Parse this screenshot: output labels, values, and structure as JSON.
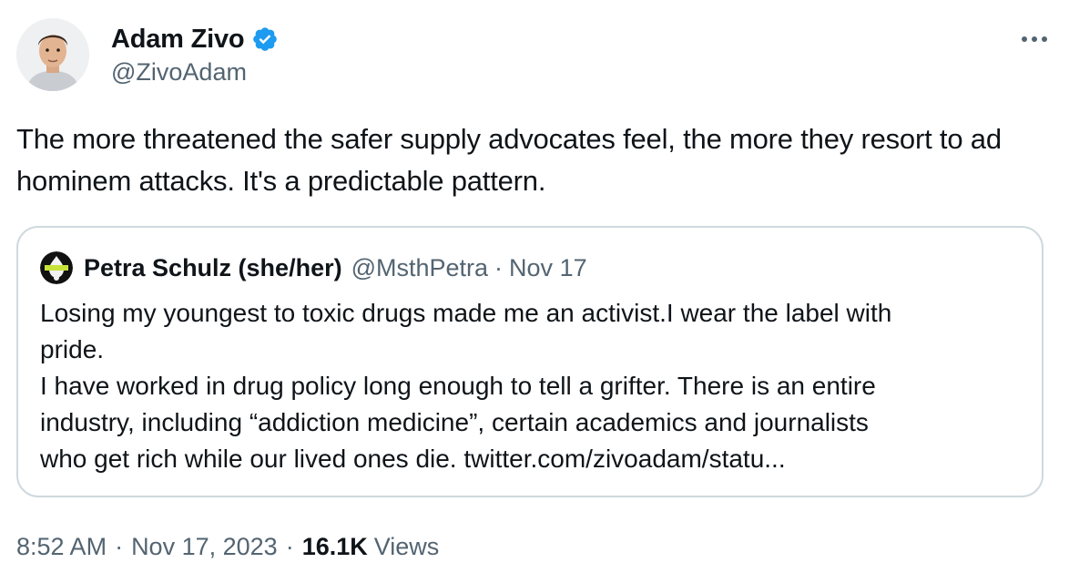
{
  "tweet": {
    "author": {
      "display_name": "Adam Zivo",
      "handle": "@ZivoAdam",
      "verified": true
    },
    "text": "The more threatened the safer supply advocates feel, the more they resort to ad hominem attacks. It's a predictable pattern.",
    "more_icon": "more-horizontal-icon",
    "quoted": {
      "display_name": "Petra Schulz (she/her)",
      "handle": "@MsthPetra",
      "dot": "·",
      "date": "Nov 17",
      "lines": [
        "Losing my youngest to toxic drugs made me an activist.I wear the label with",
        "pride.",
        "I have worked in drug policy long enough to tell a grifter. There is an entire",
        "industry, including “addiction medicine”, certain academics and journalists",
        "who get rich while our lived ones die. twitter.com/zivoadam/statu..."
      ]
    },
    "footer": {
      "time": "8:52 AM",
      "dot1": "·",
      "date": "Nov 17, 2023",
      "dot2": "·",
      "views_count": "16.1K",
      "views_label": "Views"
    }
  },
  "colors": {
    "primary_text": "#0f1419",
    "secondary_text": "#536471",
    "verified_blue": "#1d9bf0",
    "border": "#cfd9de"
  }
}
